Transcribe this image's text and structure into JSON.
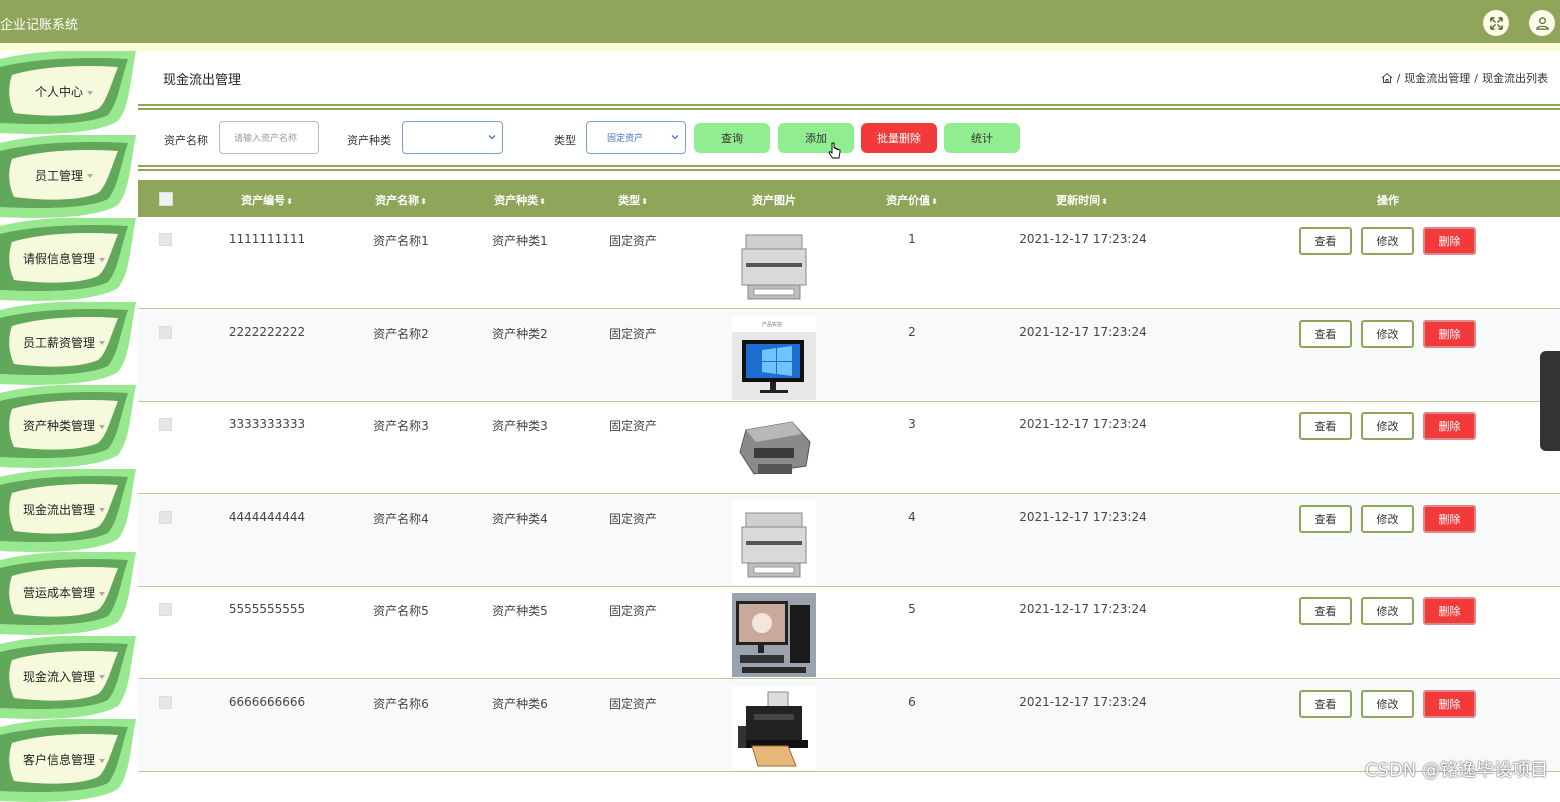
{
  "app": {
    "title": "企业记账系统",
    "colors": {
      "accent": "#8fa65a",
      "green_button": "#90ee90",
      "red_button": "#f23a3a"
    }
  },
  "header_icons": [
    "fullscreen-icon",
    "user-icon"
  ],
  "sidebar": {
    "items": [
      {
        "label": "个人中心"
      },
      {
        "label": "员工管理"
      },
      {
        "label": "请假信息管理"
      },
      {
        "label": "员工薪资管理"
      },
      {
        "label": "资产种类管理"
      },
      {
        "label": "现金流出管理"
      },
      {
        "label": "营运成本管理"
      },
      {
        "label": "现金流入管理"
      },
      {
        "label": "客户信息管理"
      }
    ]
  },
  "page": {
    "title": "现金流出管理",
    "breadcrumb": [
      "现金流出管理",
      "现金流出列表"
    ]
  },
  "filters": {
    "name_label": "资产名称",
    "name_placeholder": "请输入资产名称",
    "category_label": "资产种类",
    "category_value": "",
    "type_label": "类型",
    "type_value": "固定资产"
  },
  "buttons": {
    "query": "查询",
    "add": "添加",
    "batch_delete": "批量删除",
    "stats": "统计"
  },
  "table": {
    "columns": [
      "资产编号",
      "资产名称",
      "资产种类",
      "类型",
      "资产图片",
      "资产价值",
      "更新时间",
      "操作"
    ],
    "rows": [
      {
        "code": "1111111111",
        "name": "资产名称1",
        "category": "资产种类1",
        "type": "固定资产",
        "image": "printer-1",
        "value": "1",
        "updated": "2021-12-17 17:23:24"
      },
      {
        "code": "2222222222",
        "name": "资产名称2",
        "category": "资产种类2",
        "type": "固定资产",
        "image": "monitor",
        "value": "2",
        "updated": "2021-12-17 17:23:24"
      },
      {
        "code": "3333333333",
        "name": "资产名称3",
        "category": "资产种类3",
        "type": "固定资产",
        "image": "printer-2",
        "value": "3",
        "updated": "2021-12-17 17:23:24"
      },
      {
        "code": "4444444444",
        "name": "资产名称4",
        "category": "资产种类4",
        "type": "固定资产",
        "image": "printer-1",
        "value": "4",
        "updated": "2021-12-17 17:23:24"
      },
      {
        "code": "5555555555",
        "name": "资产名称5",
        "category": "资产种类5",
        "type": "固定资产",
        "image": "desktop-pc",
        "value": "5",
        "updated": "2021-12-17 17:23:24"
      },
      {
        "code": "6666666666",
        "name": "资产名称6",
        "category": "资产种类6",
        "type": "固定资产",
        "image": "photo-printer",
        "value": "6",
        "updated": "2021-12-17 17:23:24"
      }
    ],
    "actions": {
      "view": "查看",
      "edit": "修改",
      "delete": "删除"
    }
  },
  "watermark": "CSDN @铭逸毕设项目"
}
